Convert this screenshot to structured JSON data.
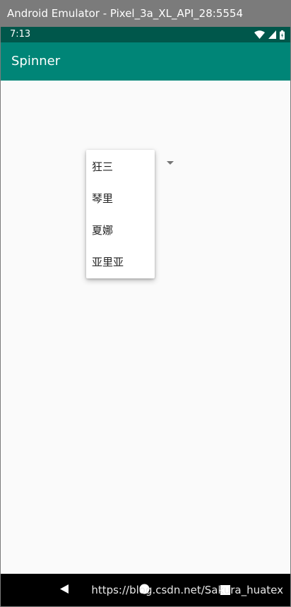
{
  "window": {
    "title": "Android Emulator - Pixel_3a_XL_API_28:5554"
  },
  "status_bar": {
    "time": "7:13"
  },
  "app_bar": {
    "title": "Spinner"
  },
  "spinner": {
    "options": [
      "狂三",
      "琴里",
      "夏娜",
      "亚里亚"
    ]
  },
  "watermark": "https://blog.csdn.net/Sakura_huatex",
  "colors": {
    "status_bar": "#00574b",
    "app_bar": "#008577",
    "background": "#fafafa",
    "frame": "#7b7b7b"
  }
}
